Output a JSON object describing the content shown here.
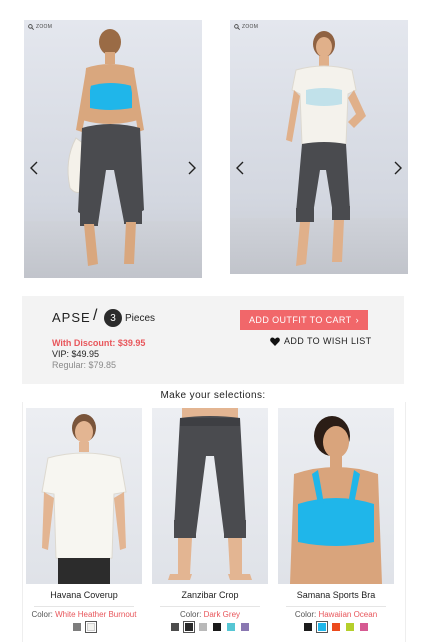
{
  "gallery": {
    "zoom_label": "ZOOM",
    "icons": {
      "zoom": "magnifier-icon",
      "prev": "chevron-left-icon",
      "next": "chevron-right-icon"
    }
  },
  "outfit": {
    "name": "APSE",
    "slash": "/",
    "pieces_count": "3",
    "pieces_label": "Pieces",
    "discount_price": "With Discount: $39.95",
    "vip_price": "VIP: $49.95",
    "regular_price": "Regular: $79.85",
    "add_to_cart": "ADD OUTFIT TO CART",
    "add_to_cart_chevron": "›",
    "wish_list": "ADD TO WISH LIST"
  },
  "selections": {
    "heading": "Make your selections:",
    "products": [
      {
        "name": "Havana Coverup",
        "color_label": "Color:",
        "color_value": "White Heather Burnout",
        "swatches": [
          "#7d7d7d",
          "#f2f2ee"
        ],
        "selected": 1
      },
      {
        "name": "Zanzibar Crop",
        "color_label": "Color:",
        "color_value": "Dark Grey",
        "swatches": [
          "#4c4c4c",
          "#2a2a2a",
          "#b9b9b9",
          "#1a1a1a",
          "#56c6d4",
          "#8a78b2"
        ],
        "selected": 1
      },
      {
        "name": "Samana Sports Bra",
        "color_label": "Color:",
        "color_value": "Hawaiian Ocean",
        "swatches": [
          "#1c1c1c",
          "#1fb6ea",
          "#ec4a1c",
          "#b5cf2b",
          "#d65a92"
        ],
        "selected": 1
      }
    ]
  },
  "colors": {
    "accent": "#f1676a",
    "sale_text": "#e8565b",
    "bra_blue": "#1fb6ea",
    "pants_grey": "#4a4b4f"
  }
}
